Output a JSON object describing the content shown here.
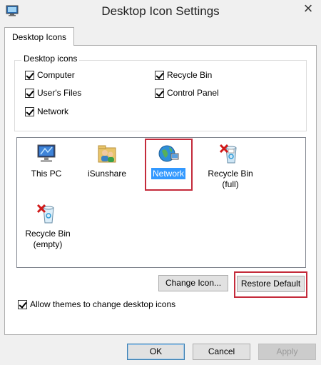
{
  "window": {
    "title": "Desktop Icon Settings",
    "close_glyph": "×"
  },
  "tab": {
    "label": "Desktop Icons"
  },
  "group": {
    "legend": "Desktop icons",
    "checkboxes": [
      {
        "label": "Computer",
        "checked": true
      },
      {
        "label": "Recycle Bin",
        "checked": true
      },
      {
        "label": "User's Files",
        "checked": true
      },
      {
        "label": "Control Panel",
        "checked": true
      },
      {
        "label": "Network",
        "checked": true
      }
    ]
  },
  "icons": [
    {
      "label": "This PC",
      "icon": "computer-icon"
    },
    {
      "label": "iSunshare",
      "icon": "user-folder-icon"
    },
    {
      "label": "Network",
      "icon": "network-icon",
      "selected": true
    },
    {
      "label": "Recycle Bin (full)",
      "line1": "Recycle Bin",
      "line2": "(full)",
      "icon": "recycle-bin-full-icon"
    },
    {
      "label": "Recycle Bin (empty)",
      "line1": "Recycle Bin",
      "line2": "(empty)",
      "icon": "recycle-bin-empty-icon"
    }
  ],
  "buttons": {
    "change_icon": "Change Icon...",
    "restore_default": "Restore Default",
    "ok": "OK",
    "cancel": "Cancel",
    "apply": "Apply"
  },
  "themes_checkbox": {
    "label": "Allow themes to change desktop icons",
    "checked": true
  },
  "colors": {
    "highlight_border": "#c42b3b",
    "selection": "#3399ff"
  }
}
